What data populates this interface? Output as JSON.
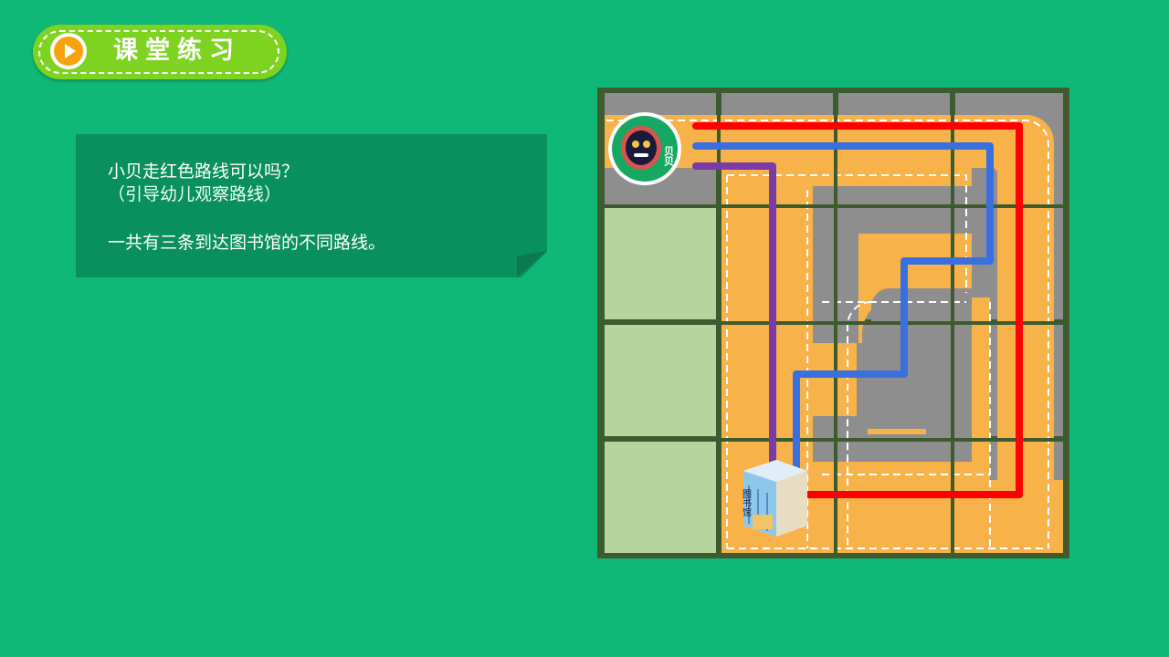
{
  "header": {
    "title": "课堂练习",
    "icon": "play-icon",
    "colors": {
      "pill": "#7ed321",
      "icon": "#f5a20d"
    }
  },
  "note": {
    "line1": "小贝走红色路线可以吗？",
    "line2": "（引导幼儿观察路线）",
    "line3": "一共有三条到达图书馆的不同路线。"
  },
  "map": {
    "start_icon": "character-avatar-icon",
    "start_label": "贝贝",
    "destination_icon": "library-building-icon",
    "destination_label": "图书馆",
    "routes": [
      {
        "name": "red-route",
        "color": "#ff0000"
      },
      {
        "name": "blue-route",
        "color": "#3a6fe0"
      },
      {
        "name": "purple-route",
        "color": "#7a3aa8"
      }
    ],
    "colors": {
      "road": "#f7b24a",
      "block": "#8e8e8e",
      "grass": "#b6d59e",
      "border": "#3d5b2e"
    }
  },
  "background_color": "#10b877"
}
